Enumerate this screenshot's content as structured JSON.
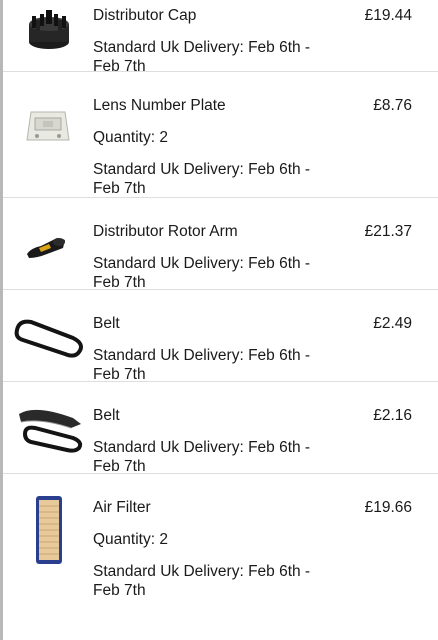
{
  "cart": {
    "items": [
      {
        "name": "Distributor Cap",
        "price": "£19.44",
        "quantity": "",
        "delivery_prefix": "Standard Uk Delivery: ",
        "delivery_dates": "Feb 6th - Feb 7th",
        "icon": "distributor-cap-icon"
      },
      {
        "name": "Lens Number Plate",
        "price": "£8.76",
        "quantity": "Quantity: 2",
        "delivery_prefix": "Standard Uk Delivery: ",
        "delivery_dates": "Feb 6th - Feb 7th",
        "icon": "lens-number-plate-icon"
      },
      {
        "name": "Distributor Rotor Arm",
        "price": "£21.37",
        "quantity": "",
        "delivery_prefix": "Standard Uk Delivery: ",
        "delivery_dates": "Feb 6th - Feb 7th",
        "icon": "rotor-arm-icon"
      },
      {
        "name": "Belt",
        "price": "£2.49",
        "quantity": "",
        "delivery_prefix": "Standard Uk Delivery: ",
        "delivery_dates": "Feb 6th - Feb 7th",
        "icon": "belt-icon"
      },
      {
        "name": "Belt",
        "price": "£2.16",
        "quantity": "",
        "delivery_prefix": "Standard Uk Delivery: ",
        "delivery_dates": "Feb 6th - Feb 7th",
        "icon": "belt-icon"
      },
      {
        "name": "Air Filter",
        "price": "£19.66",
        "quantity": "Quantity: 2",
        "delivery_prefix": "Standard Uk Delivery: ",
        "delivery_dates": "Feb 6th - Feb 7th",
        "icon": "air-filter-icon"
      }
    ]
  }
}
